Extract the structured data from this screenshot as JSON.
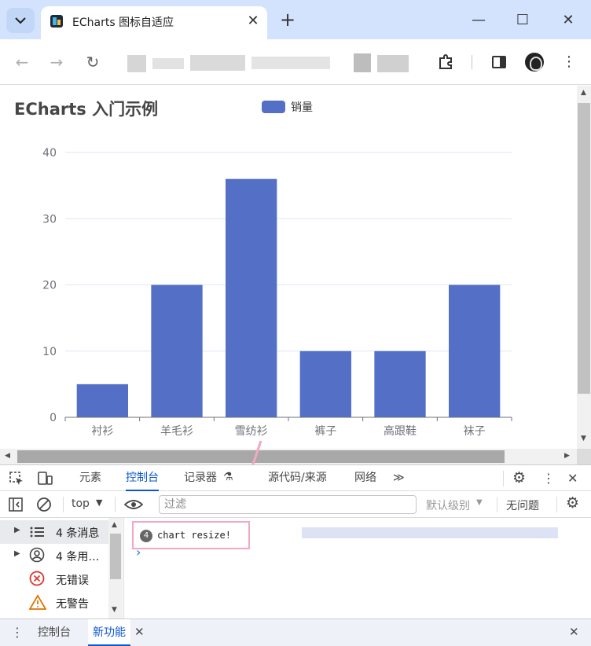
{
  "browser": {
    "tab_title": "ECharts 图标自适应",
    "new_tab_symbol": "+",
    "close_symbol": "✕",
    "minimize_symbol": "—",
    "maximize_symbol": "☐",
    "window_close_symbol": "✕",
    "menu_symbol": "⋮",
    "back_symbol": "←",
    "forward_symbol": "→",
    "reload_symbol": "↻"
  },
  "page": {
    "chart_title": "ECharts 入门示例",
    "legend_label": "销量",
    "series_color": "#5470c6"
  },
  "chart_data": {
    "type": "bar",
    "title": "ECharts 入门示例",
    "categories": [
      "衬衫",
      "羊毛衫",
      "雪纺衫",
      "裤子",
      "高跟鞋",
      "袜子"
    ],
    "series": [
      {
        "name": "销量",
        "values": [
          5,
          20,
          36,
          10,
          10,
          20
        ]
      }
    ],
    "yticks": [
      0,
      10,
      20,
      30,
      40
    ],
    "ylim": [
      0,
      40
    ],
    "grid": true,
    "legend": "top-center"
  },
  "devtools": {
    "tabs": [
      "元素",
      "控制台",
      "记录器",
      "源代码/来源",
      "网络"
    ],
    "more_tabs": "≫",
    "context_value": "top",
    "filter_placeholder": "过滤",
    "levels_label": "默认级别",
    "issues_label": "无问题",
    "sidebar": [
      {
        "icon": "list-icon",
        "label": "4 条消息"
      },
      {
        "icon": "user-icon",
        "label": "4 条用…"
      },
      {
        "icon": "error-icon",
        "label": "无错误"
      },
      {
        "icon": "warning-icon",
        "label": "无警告"
      }
    ],
    "message": {
      "count": "4",
      "text": "chart resize!"
    },
    "prompt_symbol": "›",
    "drawer_tabs": [
      "控制台",
      "新功能"
    ]
  }
}
